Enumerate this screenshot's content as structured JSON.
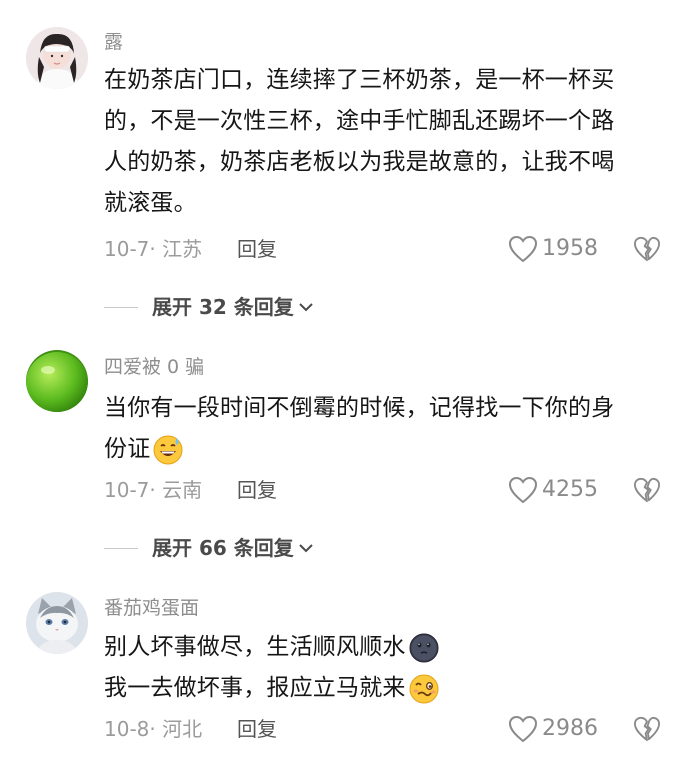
{
  "comments": [
    {
      "author": "露",
      "lines": [
        "在奶茶店门口，连续摔了三杯奶茶，是一杯一杯买",
        "的，不是一次性三杯，途中手忙脚乱还踢坏一个路",
        "人的奶茶，奶茶店老板以为我是故意的，让我不喝",
        "就滚蛋。"
      ],
      "date_location": "10-7· 江苏",
      "reply_label": "回复",
      "likes": "1958",
      "expand_label": "展开 32 条回复"
    },
    {
      "author": "四爱被 0 骗",
      "lines": [
        "当你有一段时间不倒霉的时候，记得找一下你的身",
        "份证"
      ],
      "emoji": "grinning-sweat-emoji",
      "date_location": "10-7· 云南",
      "reply_label": "回复",
      "likes": "4255",
      "expand_label": "展开 66 条回复"
    },
    {
      "author": "番茄鸡蛋面",
      "lines": [
        "别人坏事做尽，生活顺风顺水",
        "我一去做坏事，报应立马就来"
      ],
      "emojis": [
        "dark-face-emoji",
        "woozy-face-emoji"
      ],
      "date_location": "10-8· 河北",
      "reply_label": "回复",
      "likes": "2986"
    }
  ],
  "colors": {
    "meta": "#9b9b9b",
    "text": "#161616",
    "accent": "#4a4a4a"
  }
}
